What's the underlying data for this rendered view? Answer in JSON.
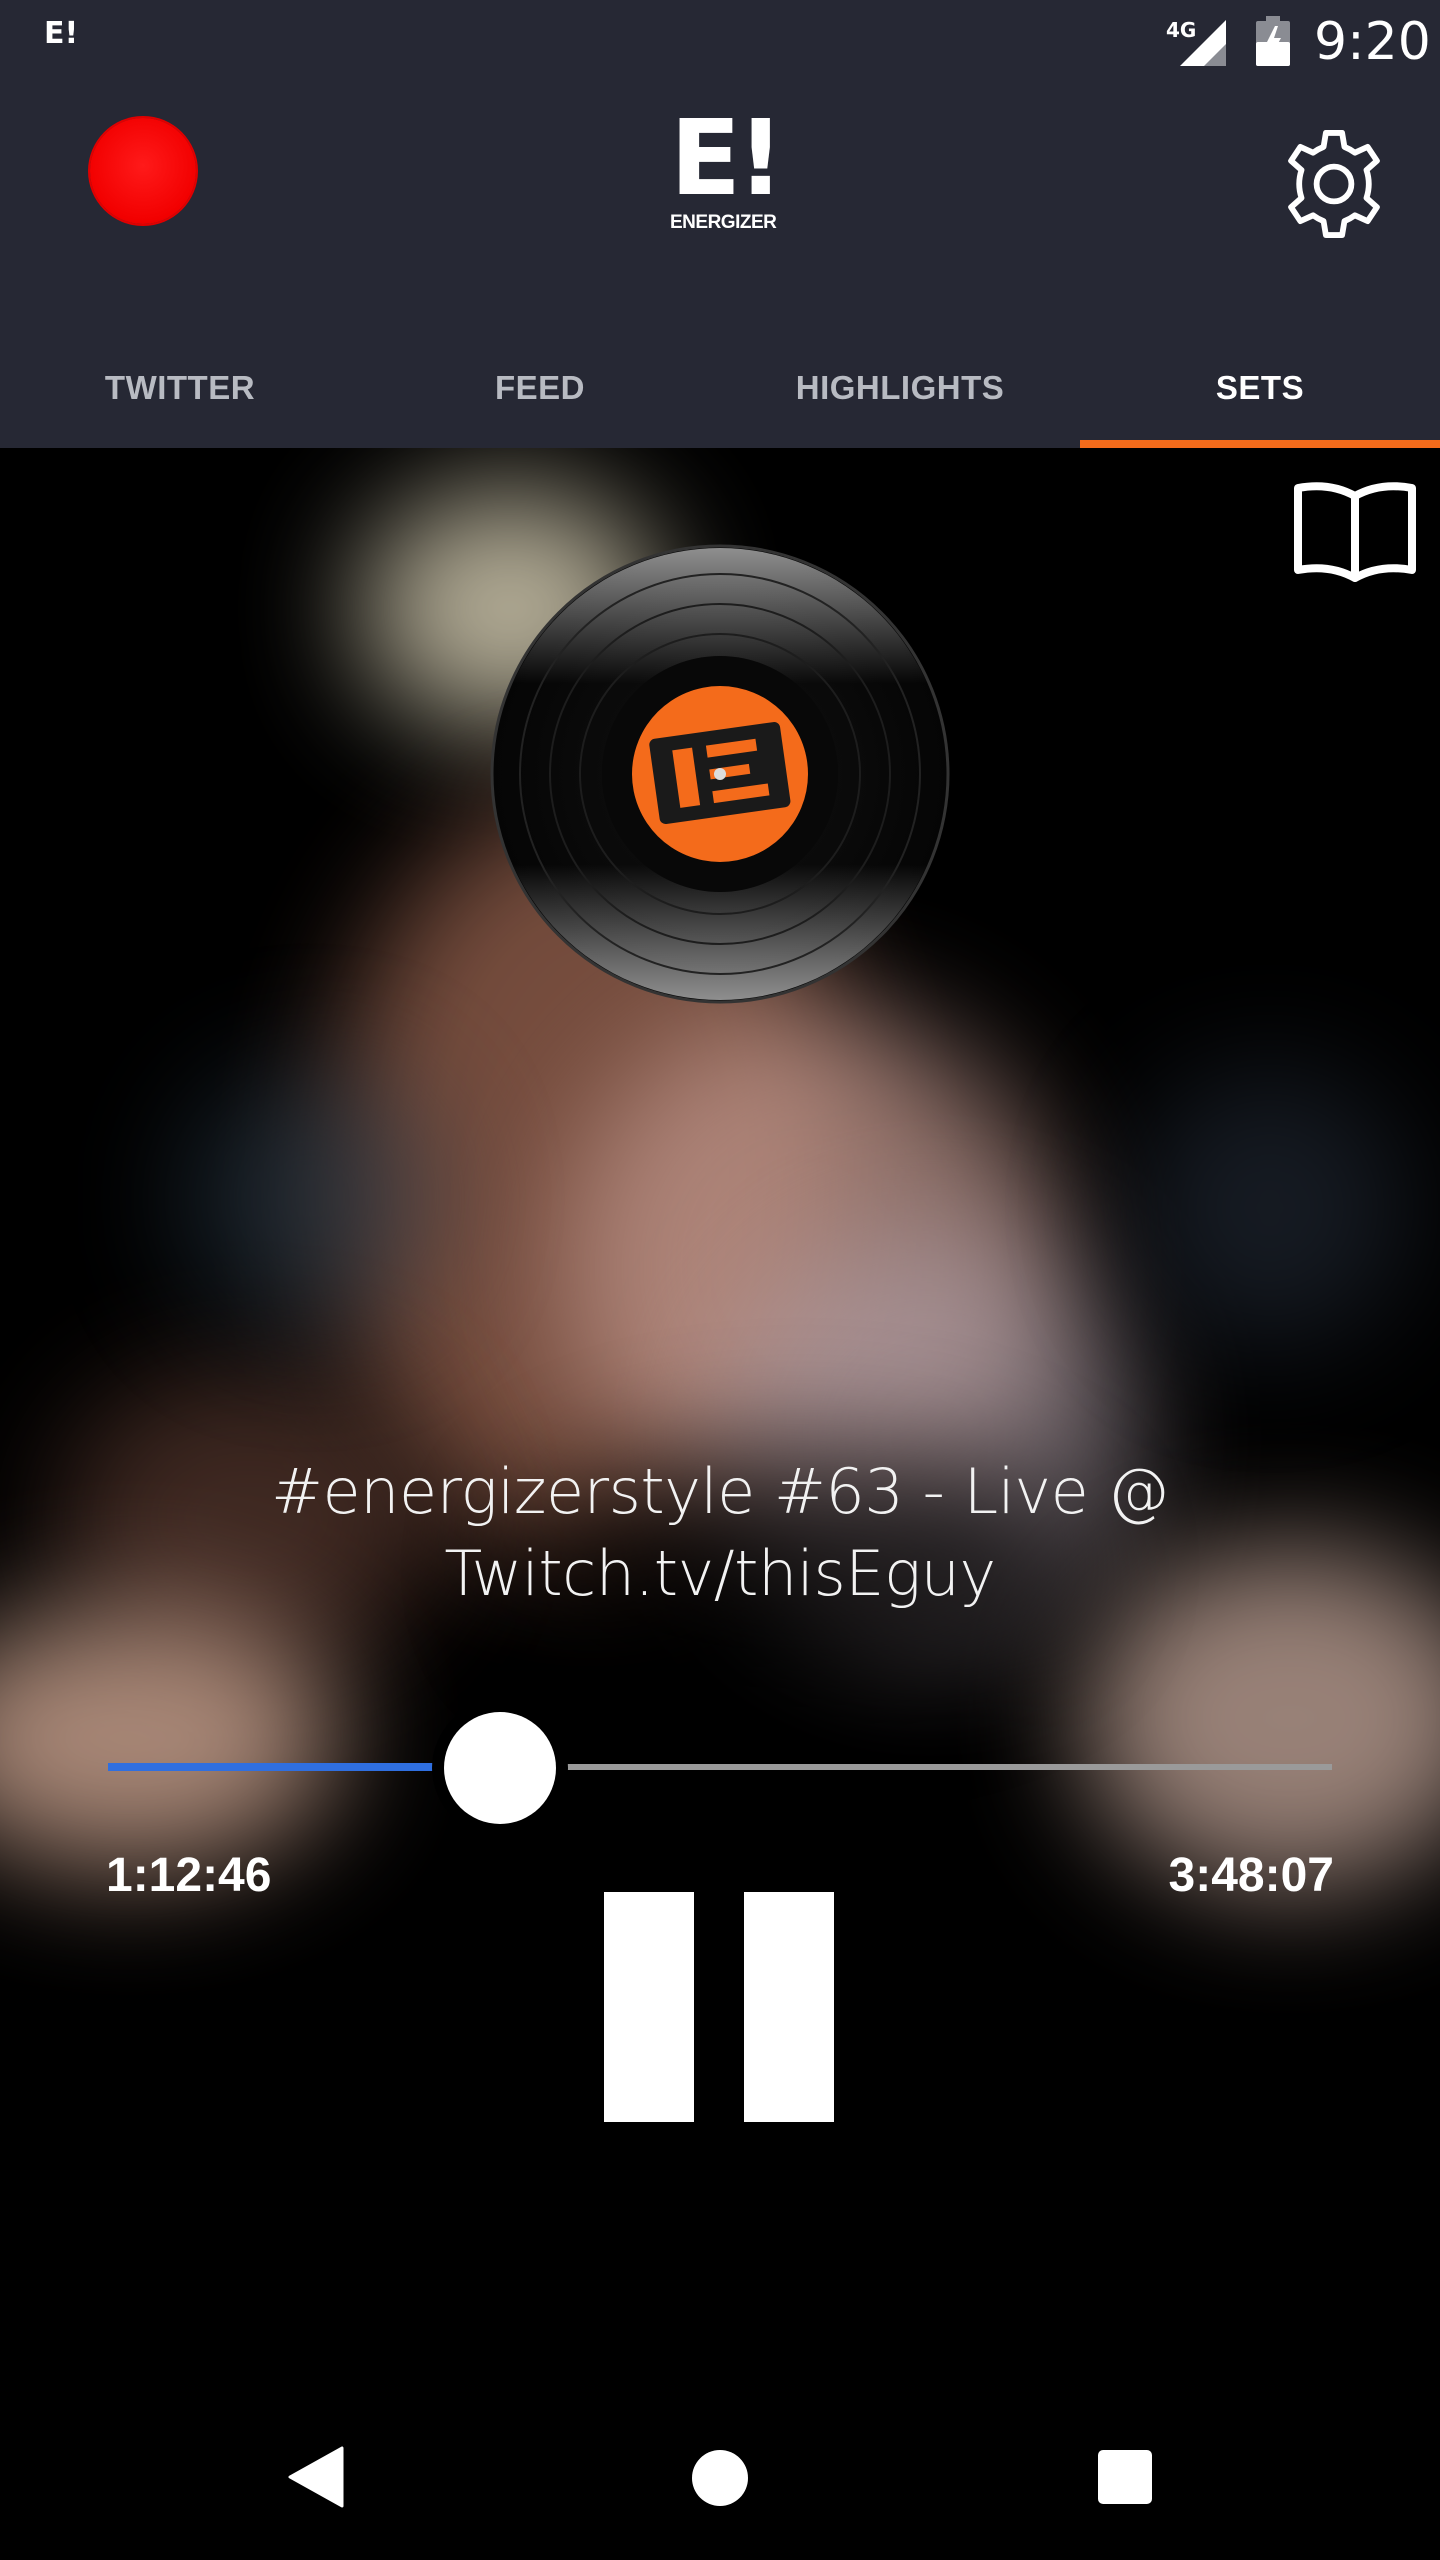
{
  "status_bar": {
    "app_logo": "E!",
    "network": "4G",
    "time": "9:20"
  },
  "app_bar": {
    "logo_big": "E!",
    "logo_small": "ENERGIZER",
    "record_color": "#f20000",
    "icons": [
      "record-icon",
      "gear-icon"
    ]
  },
  "tabs": [
    {
      "label": "TWITTER",
      "active": false
    },
    {
      "label": "FEED",
      "active": false
    },
    {
      "label": "HIGHLIGHTS",
      "active": false
    },
    {
      "label": "SETS",
      "active": true
    }
  ],
  "accent_color": "#f46b1b",
  "player": {
    "title": "#energizerstyle #63 - Live @ Twitch.tv/thisEguy",
    "elapsed": "1:12:46",
    "total": "3:48:07",
    "progress_fraction": 0.32,
    "seek_color": "#2f6fe0",
    "icons": [
      "book-icon",
      "vinyl-record-icon",
      "pause-icon"
    ]
  },
  "nav_bar": {
    "icons": [
      "back-icon",
      "home-icon",
      "recents-icon"
    ]
  }
}
